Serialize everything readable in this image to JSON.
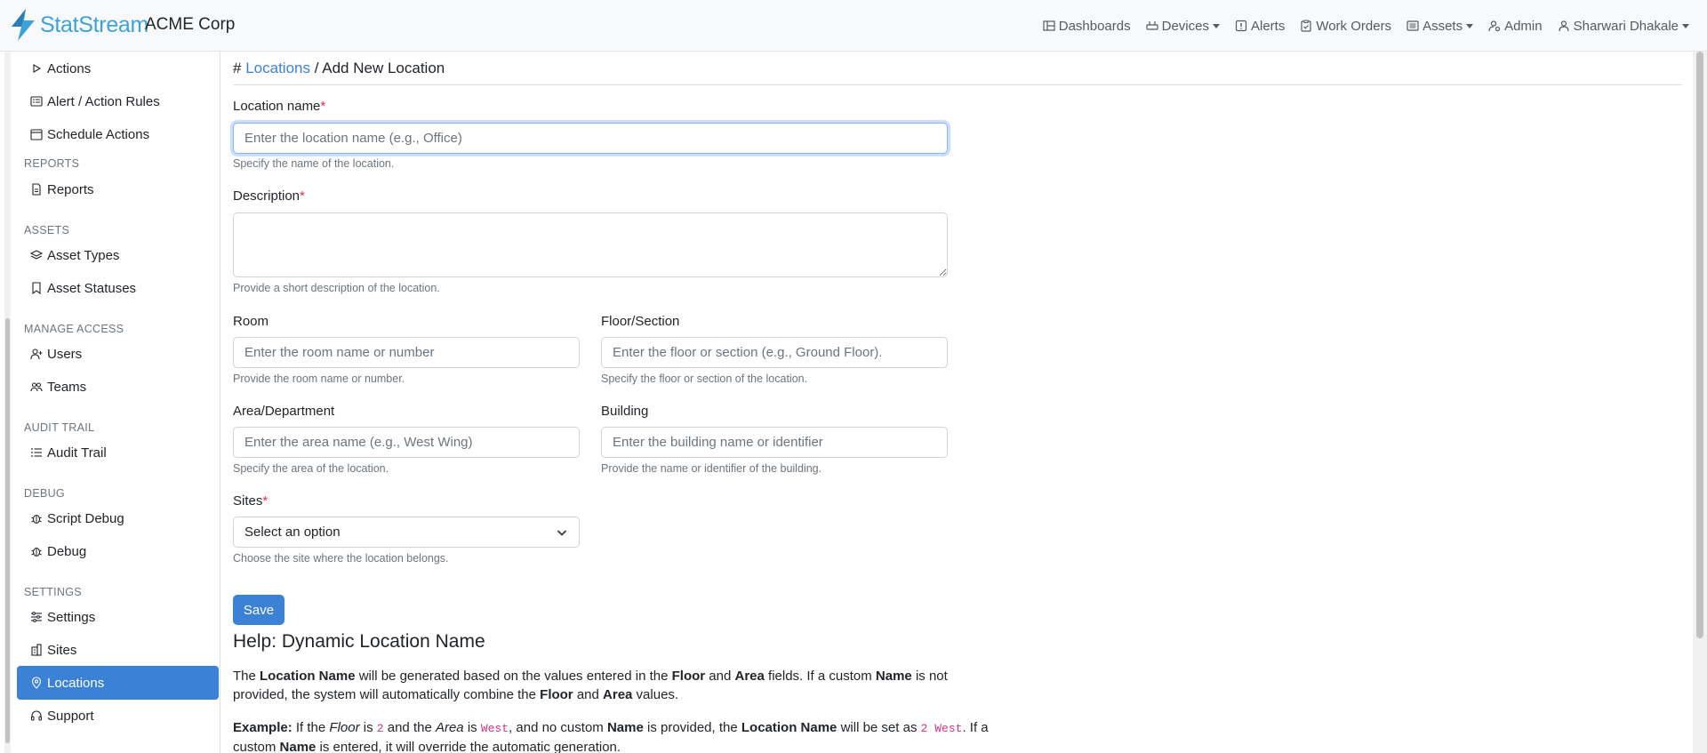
{
  "app": {
    "brand": "StatStream",
    "org": "ACME Corp",
    "brand_color": "#3ea2da",
    "accent_color": "#3b82d6"
  },
  "nav": [
    {
      "label": "Dashboards",
      "icon": "dashboard-icon"
    },
    {
      "label": "Devices",
      "icon": "devices-icon",
      "dropdown": true
    },
    {
      "label": "Alerts",
      "icon": "alert-icon"
    },
    {
      "label": "Work Orders",
      "icon": "clipboard-icon"
    },
    {
      "label": "Assets",
      "icon": "assets-icon",
      "dropdown": true
    },
    {
      "label": "Admin",
      "icon": "admin-icon"
    },
    {
      "label": "Sharwari Dhakale",
      "icon": "user-icon",
      "dropdown": true
    }
  ],
  "sidebar": {
    "items_top": [
      {
        "label": "Actions",
        "icon": "play-icon"
      },
      {
        "label": "Alert / Action Rules",
        "icon": "rules-icon"
      },
      {
        "label": "Schedule Actions",
        "icon": "calendar-icon"
      }
    ],
    "sections": [
      {
        "heading": "REPORTS",
        "items": [
          {
            "label": "Reports",
            "icon": "file-icon"
          }
        ]
      },
      {
        "heading": "ASSETS",
        "items": [
          {
            "label": "Asset Types",
            "icon": "layers-icon"
          },
          {
            "label": "Asset Statuses",
            "icon": "bookmark-icon"
          }
        ]
      },
      {
        "heading": "MANAGE ACCESS",
        "items": [
          {
            "label": "Users",
            "icon": "user-add-icon"
          },
          {
            "label": "Teams",
            "icon": "team-icon"
          }
        ]
      },
      {
        "heading": "AUDIT TRAIL",
        "items": [
          {
            "label": "Audit Trail",
            "icon": "list-icon"
          }
        ]
      },
      {
        "heading": "DEBUG",
        "items": [
          {
            "label": "Script Debug",
            "icon": "bug-icon"
          },
          {
            "label": "Debug",
            "icon": "bug-icon"
          }
        ]
      },
      {
        "heading": "SETTINGS",
        "items": [
          {
            "label": "Settings",
            "icon": "sliders-icon"
          },
          {
            "label": "Sites",
            "icon": "building-icon"
          },
          {
            "label": "Locations",
            "icon": "map-pin-icon",
            "active": true
          },
          {
            "label": "Support",
            "icon": "headset-icon"
          }
        ]
      }
    ]
  },
  "breadcrumb": {
    "hash": "#",
    "parent": "Locations",
    "separator": "/",
    "current": "Add New Location"
  },
  "form": {
    "name": {
      "label": "Location name",
      "required": "*",
      "placeholder": "Enter the location name (e.g., Office)",
      "help": "Specify the name of the location."
    },
    "description": {
      "label": "Description",
      "required": "*",
      "placeholder": "",
      "help": "Provide a short description of the location."
    },
    "room": {
      "label": "Room",
      "placeholder": "Enter the room name or number",
      "help": "Provide the room name or number."
    },
    "floor": {
      "label": "Floor/Section",
      "placeholder": "Enter the floor or section (e.g., Ground Floor).",
      "help": "Specify the floor or section of the location."
    },
    "area": {
      "label": "Area/Department",
      "placeholder": "Enter the area name (e.g., West Wing)",
      "help": "Specify the area of the location."
    },
    "building": {
      "label": "Building",
      "placeholder": "Enter the building name or identifier",
      "help": "Provide the name or identifier of the building."
    },
    "sites": {
      "label": "Sites",
      "required": "*",
      "selected": "Select an option",
      "help": "Choose the site where the location belongs."
    },
    "save_label": "Save"
  },
  "help": {
    "title": "Help: Dynamic Location Name",
    "p1": {
      "t1": "The ",
      "b1": "Location Name",
      "t2": " will be generated based on the values entered in the ",
      "b2": "Floor",
      "t3": " and ",
      "b3": "Area",
      "t4": " fields. If a custom ",
      "b4": "Name",
      "t5": " is not provided, the system will automatically combine the ",
      "b5": "Floor",
      "t6": " and ",
      "b6": "Area",
      "t7": " values."
    },
    "p2": {
      "b1": "Example:",
      "t1": " If the ",
      "i1": "Floor",
      "t2": " is ",
      "c1": "2",
      "t3": " and the ",
      "i2": "Area",
      "t4": " is ",
      "c2": "West",
      "t5": ", and no custom ",
      "b2": "Name",
      "t6": " is provided, the ",
      "b3": "Location Name",
      "t7": " will be set as ",
      "c3": "2 West",
      "t8": ". If a custom ",
      "b4": "Name",
      "t9": " is entered, it will override the automatic generation."
    }
  }
}
